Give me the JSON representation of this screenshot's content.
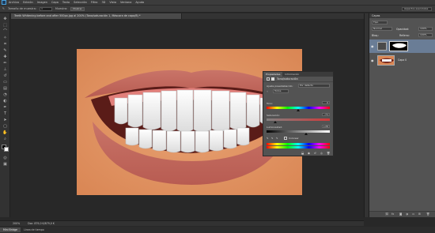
{
  "app": {
    "menus": [
      "Archivo",
      "Edición",
      "Imagen",
      "Capa",
      "Texto",
      "Selección",
      "Filtro",
      "3D",
      "Vista",
      "Ventana",
      "Ayuda"
    ]
  },
  "options_bar": {
    "tool_label": "Tamaño de muestra:",
    "field_value": "4",
    "sample_label": "Muestra:",
    "button_label": "Mostrar",
    "workspace": "Aspectos esenciales"
  },
  "document": {
    "tab_title": "Teeth Whitening before and after 500px.jpg al 200% (Tono/saturación 1, Máscara de capa/8) *",
    "zoom": "200%",
    "doc_info": "Doc: 879,0 K/879,0 K"
  },
  "properties_panel": {
    "tabs": [
      "Propiedades",
      "Información"
    ],
    "title": "Tono/saturación",
    "preset_label": "Ajuste preestablecido:",
    "preset_value": "Por defecto",
    "channel_value": "Todos",
    "hue_label": "Tono:",
    "hue_value": "0",
    "saturation_label": "Saturación:",
    "saturation_value": "-71",
    "lightness_label": "Luminosidad:",
    "lightness_value": "+26",
    "colorize_label": "Colorear"
  },
  "layers_panel": {
    "header": "Capas",
    "kind_label": "Tipo",
    "mode_value": "Normal",
    "opacity_label": "Opacidad:",
    "opacity_value": "100%",
    "lock_label": "Bloq.:",
    "fill_label": "Relleno:",
    "fill_value": "100%",
    "layers": [
      {
        "name": "",
        "type": "adjustment"
      },
      {
        "name": "Capa 0",
        "type": "image"
      }
    ]
  },
  "bottom_tabs": [
    "Mini Bridge",
    "Línea de tiempo"
  ],
  "colors": {
    "accent": "#4aa3df",
    "panel_bg": "#535353",
    "app_bg": "#282828"
  }
}
